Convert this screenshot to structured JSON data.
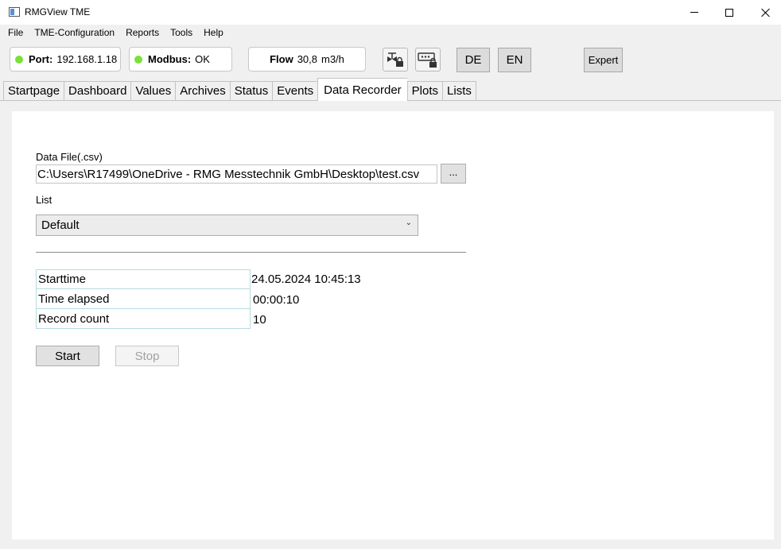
{
  "window": {
    "title": "RMGView TME"
  },
  "menu": {
    "items": [
      "File",
      "TME-Configuration",
      "Reports",
      "Tools",
      "Help"
    ]
  },
  "status": {
    "port_label": "Port:",
    "port_value": "192.168.1.18",
    "modbus_label": "Modbus:",
    "modbus_value": "OK",
    "flow_label": "Flow",
    "flow_value": "30,8",
    "flow_unit": "m3/h",
    "indicator_color": "#7be03a"
  },
  "toolbar": {
    "icon_1": "valve-lock-icon",
    "icon_2": "password-lock-icon",
    "lang_de": "DE",
    "lang_en": "EN",
    "expert_label": "Expert"
  },
  "tabs": [
    {
      "label": "Startpage"
    },
    {
      "label": "Dashboard"
    },
    {
      "label": "Values"
    },
    {
      "label": "Archives"
    },
    {
      "label": "Status"
    },
    {
      "label": "Events"
    },
    {
      "label": "Data Recorder",
      "active": true
    },
    {
      "label": "Plots"
    },
    {
      "label": "Lists"
    }
  ],
  "recorder": {
    "data_file_label": "Data File(.csv)",
    "data_file_value": "C:\\Users\\R17499\\OneDrive - RMG Messtechnik GmbH\\Desktop\\test.csv",
    "browse_label": "...",
    "list_label": "List",
    "list_selected": "Default",
    "info": [
      {
        "label": "Starttime",
        "value": "24.05.2024 10:45:13"
      },
      {
        "label": "Time elapsed",
        "value": "00:00:10"
      },
      {
        "label": "Record count",
        "value": "10"
      }
    ],
    "start_label": "Start",
    "stop_label": "Stop"
  }
}
